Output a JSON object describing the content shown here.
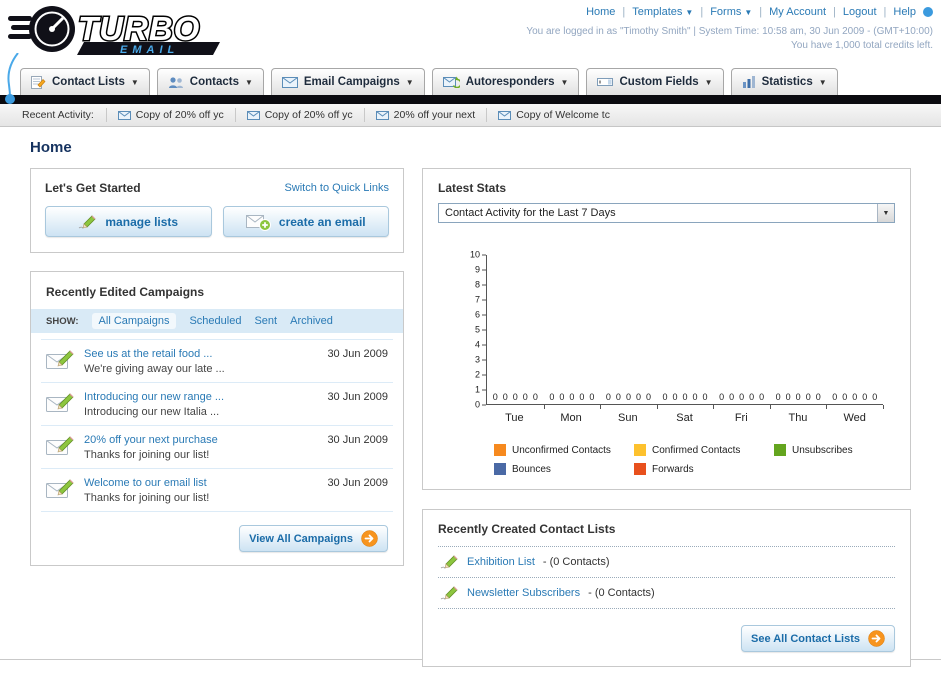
{
  "header": {
    "logo_title": "TURBO",
    "logo_subtitle": "EMAIL",
    "nav": {
      "home": "Home",
      "templates": "Templates",
      "forms": "Forms",
      "my_account": "My Account",
      "logout": "Logout",
      "help": "Help"
    },
    "login_info": "You are logged in as \"Timothy Smith\" | System Time: 10:58 am, 30 Jun 2009 - (GMT+10:00)",
    "credits_info": "You have 1,000 total credits left."
  },
  "nav_tabs": [
    {
      "label": "Contact Lists"
    },
    {
      "label": "Contacts"
    },
    {
      "label": "Email Campaigns"
    },
    {
      "label": "Autoresponders"
    },
    {
      "label": "Custom Fields"
    },
    {
      "label": "Statistics"
    }
  ],
  "recent_activity": {
    "label": "Recent Activity:",
    "items": [
      {
        "text": "Copy of 20% off yc"
      },
      {
        "text": "Copy of 20% off yc"
      },
      {
        "text": "20% off your next"
      },
      {
        "text": "Copy of Welcome tc"
      }
    ]
  },
  "page": {
    "title": "Home"
  },
  "get_started": {
    "title": "Let's Get Started",
    "switch_link": "Switch to Quick Links",
    "manage_lists_button": "manage lists",
    "create_email_button": "create an email"
  },
  "campaigns": {
    "title": "Recently Edited Campaigns",
    "show_label": "SHOW:",
    "tabs": [
      {
        "label": "All Campaigns"
      },
      {
        "label": "Scheduled"
      },
      {
        "label": "Sent"
      },
      {
        "label": "Archived"
      }
    ],
    "items": [
      {
        "title": "See us at the retail food ...",
        "subtitle": "We're giving away our late ...",
        "date": "30 Jun 2009"
      },
      {
        "title": "Introducing our new range ...",
        "subtitle": "Introducing our new Italia ...",
        "date": "30 Jun 2009"
      },
      {
        "title": "20% off your next purchase",
        "subtitle": "Thanks for joining our list!",
        "date": "30 Jun 2009"
      },
      {
        "title": "Welcome to our email list",
        "subtitle": "Thanks for joining our list!",
        "date": "30 Jun 2009"
      }
    ],
    "view_all_button": "View All Campaigns"
  },
  "stats": {
    "title": "Latest Stats",
    "filter_value": "Contact Activity for the Last 7 Days"
  },
  "chart_data": {
    "type": "bar",
    "title": "Contact Activity for the Last 7 Days",
    "categories": [
      "Tue",
      "Mon",
      "Sun",
      "Sat",
      "Fri",
      "Thu",
      "Wed"
    ],
    "series": [
      {
        "name": "Unconfirmed Contacts",
        "color": "#f6891f",
        "values": [
          0,
          0,
          0,
          0,
          0,
          0,
          0
        ]
      },
      {
        "name": "Confirmed Contacts",
        "color": "#fdc12d",
        "values": [
          0,
          0,
          0,
          0,
          0,
          0,
          0
        ]
      },
      {
        "name": "Unsubscribes",
        "color": "#64a51f",
        "values": [
          0,
          0,
          0,
          0,
          0,
          0,
          0
        ]
      },
      {
        "name": "Bounces",
        "color": "#4a69a5",
        "values": [
          0,
          0,
          0,
          0,
          0,
          0,
          0
        ]
      },
      {
        "name": "Forwards",
        "color": "#e8501d",
        "values": [
          0,
          0,
          0,
          0,
          0,
          0,
          0
        ]
      }
    ],
    "ylim": [
      0,
      10
    ],
    "yticks": [
      0,
      1,
      2,
      3,
      4,
      5,
      6,
      7,
      8,
      9,
      10
    ],
    "show_value_labels": true,
    "legend_position": "bottom",
    "grid": false
  },
  "contact_lists": {
    "title": "Recently Created Contact Lists",
    "items": [
      {
        "name": "Exhibition List",
        "count": "- (0 Contacts)"
      },
      {
        "name": "Newsletter Subscribers",
        "count": "- (0 Contacts)"
      }
    ],
    "see_all_button": "See All Contact Lists"
  },
  "colors": {
    "link": "#2a7ab5",
    "accent_orange": "#f7941e",
    "dark_bar": "#0b0b10"
  }
}
